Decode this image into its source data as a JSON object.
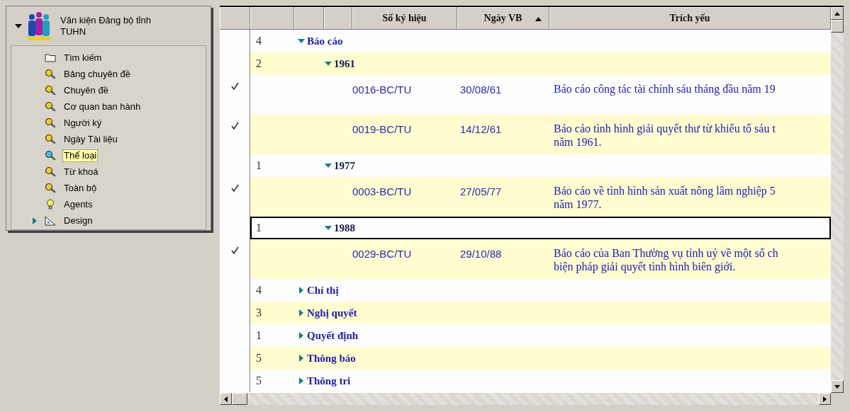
{
  "sidebar": {
    "title": "Văn kiện Đảng bộ tỉnh TUHN",
    "expanded": true,
    "items": [
      {
        "kind": "folder",
        "label": "Tìm kiếm",
        "selected": false
      },
      {
        "kind": "search",
        "label": "Bảng chuyên đề",
        "selected": false
      },
      {
        "kind": "search",
        "label": "Chuyên đề",
        "selected": false
      },
      {
        "kind": "search",
        "label": "Cơ quan ban hành",
        "selected": false
      },
      {
        "kind": "search",
        "label": "Người ký",
        "selected": false
      },
      {
        "kind": "search",
        "label": "Ngày Tài liệu",
        "selected": false
      },
      {
        "kind": "search",
        "label": "Thể loại",
        "selected": true
      },
      {
        "kind": "search",
        "label": "Từ khoá",
        "selected": false
      },
      {
        "kind": "search",
        "label": "Toàn bộ",
        "selected": false
      },
      {
        "kind": "agent",
        "label": "Agents",
        "selected": false
      },
      {
        "kind": "design",
        "label": "Design",
        "selected": false,
        "expanded": false
      }
    ]
  },
  "grid": {
    "columns": [
      {
        "label": "Số ký hiệu",
        "sorted": false
      },
      {
        "label": "Ngày VB",
        "sorted": true
      },
      {
        "label": "Trích yếu",
        "sorted": false
      }
    ],
    "rows": [
      {
        "kind": "category",
        "count": "4",
        "label": "Báo cáo",
        "expanded": true,
        "selected": false,
        "children": [
          {
            "kind": "year",
            "count": "2",
            "label": "1961",
            "expanded": true,
            "selected": false,
            "children": [
              {
                "kind": "document",
                "checked": true,
                "number": "0016-BC/TU",
                "date": "30/08/61",
                "summary": [
                  "Báo cáo công tác tài chính sáu tháng đầu năm 19"
                ]
              },
              {
                "kind": "document",
                "checked": true,
                "number": "0019-BC/TU",
                "date": "14/12/61",
                "summary": [
                  "Báo cáo tình hình giải quyết thư từ khiếu tố sáu t",
                  "năm 1961."
                ]
              }
            ]
          },
          {
            "kind": "year",
            "count": "1",
            "label": "1977",
            "expanded": true,
            "selected": false,
            "children": [
              {
                "kind": "document",
                "checked": true,
                "number": "0003-BC/TU",
                "date": "27/05/77",
                "summary": [
                  "Báo cáo về tình hình sản xuất nông lâm nghiệp 5",
                  "năm 1977."
                ]
              }
            ]
          },
          {
            "kind": "year",
            "count": "1",
            "label": "1988",
            "expanded": true,
            "selected": true,
            "children": [
              {
                "kind": "document",
                "checked": true,
                "number": "0029-BC/TU",
                "date": "29/10/88",
                "summary": [
                  "Báo cáo của Ban Thường vụ tỉnh uỷ về một số ch",
                  "biện pháp giải quyết tình hình biên giới."
                ]
              }
            ]
          }
        ]
      },
      {
        "kind": "category",
        "count": "4",
        "label": "Chỉ thị",
        "expanded": false,
        "selected": false
      },
      {
        "kind": "category",
        "count": "3",
        "label": "Nghị quyết",
        "expanded": false,
        "selected": false
      },
      {
        "kind": "category",
        "count": "1",
        "label": "Quyết định",
        "expanded": false,
        "selected": false
      },
      {
        "kind": "category",
        "count": "5",
        "label": "Thông báo",
        "expanded": false,
        "selected": false
      },
      {
        "kind": "category",
        "count": "5",
        "label": "Thông tri",
        "expanded": false,
        "selected": false
      }
    ]
  }
}
